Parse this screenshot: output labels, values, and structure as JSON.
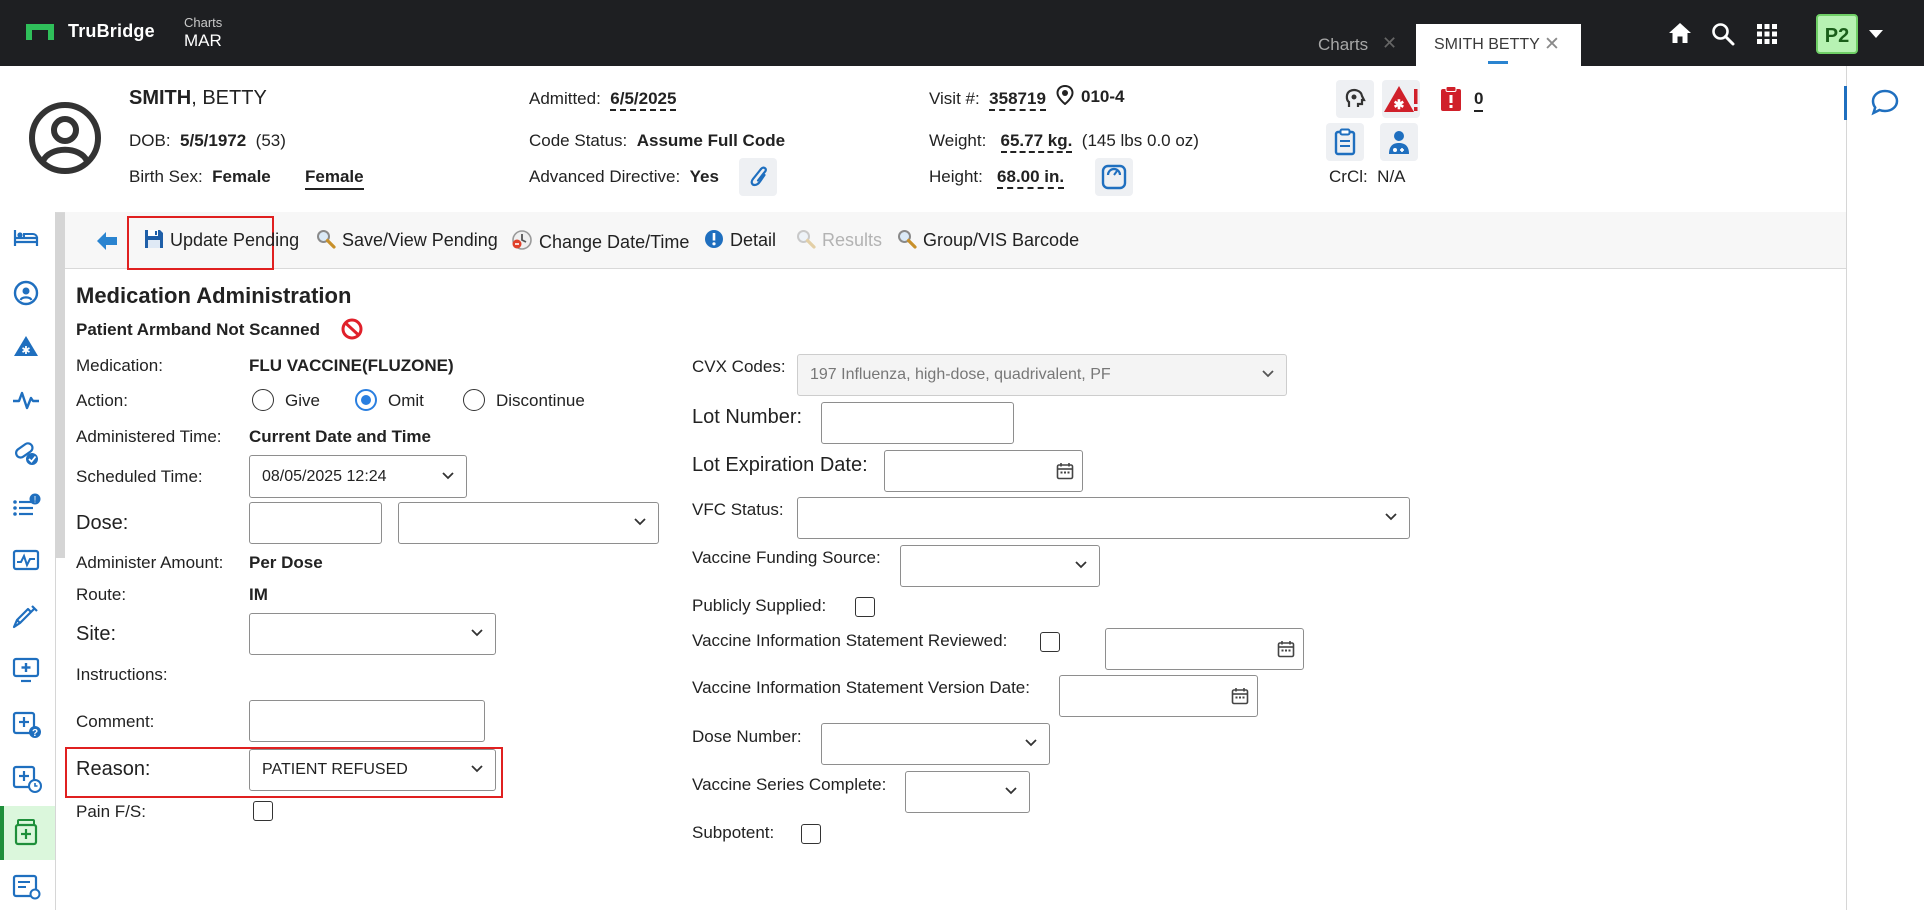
{
  "app": {
    "brand": "TruBridge",
    "section": "Charts",
    "page": "MAR",
    "tabs": [
      {
        "label": "Charts",
        "close": "✕"
      },
      {
        "label": "SMITH BETTY",
        "close": "✕"
      }
    ],
    "user_initials": "P2"
  },
  "patient": {
    "last_name": "SMITH",
    "first_name": ", BETTY",
    "dob_label": "DOB:",
    "dob": "5/5/1972",
    "age": "(53)",
    "birth_sex_label": "Birth Sex:",
    "birth_sex": "Female",
    "gender_link": "Female",
    "admitted_label": "Admitted:",
    "admitted": "6/5/2025",
    "code_status_label": "Code Status:",
    "code_status": "Assume Full Code",
    "adv_directive_label": "Advanced Directive:",
    "adv_directive": "Yes",
    "visit_label": "Visit #:",
    "visit": "358719",
    "room": "010-4",
    "weight_label": "Weight:",
    "weight": "65.77 kg.",
    "weight_lbs": "(145 lbs 0.0 oz)",
    "height_label": "Height:",
    "height": "68.00 in.",
    "alerts_count": "0",
    "crcl_label": "CrCl:",
    "crcl": "N/A"
  },
  "toolbar": {
    "update_pending": "Update Pending",
    "save_view_pending": "Save/View Pending",
    "change_datetime": "Change Date/Time",
    "detail": "Detail",
    "results": "Results",
    "group_vis_barcode": "Group/VIS Barcode"
  },
  "form": {
    "title": "Medication Administration",
    "armband": "Patient Armband Not Scanned",
    "medication_label": "Medication:",
    "medication": "FLU VACCINE(FLUZONE)",
    "action_label": "Action:",
    "action_options": [
      "Give",
      "Omit",
      "Discontinue"
    ],
    "action_selected": "Omit",
    "admin_time_label": "Administered Time:",
    "admin_time": "Current Date and Time",
    "scheduled_time_label": "Scheduled Time:",
    "scheduled_time": "08/05/2025 12:24",
    "dose_label": "Dose:",
    "dose_value": "",
    "dose_unit": "",
    "administer_amount_label": "Administer Amount:",
    "administer_amount": "Per Dose",
    "route_label": "Route:",
    "route": "IM",
    "site_label": "Site:",
    "site": "",
    "instructions_label": "Instructions:",
    "comment_label": "Comment:",
    "comment": "",
    "reason_label": "Reason:",
    "reason": "PATIENT REFUSED",
    "pain_label": "Pain F/S:",
    "pain_checked": false
  },
  "vaccine": {
    "cvx_label": "CVX Codes:",
    "cvx_value": "197 Influenza, high-dose, quadrivalent, PF",
    "lot_number_label": "Lot Number:",
    "lot_number": "",
    "lot_exp_label": "Lot Expiration Date:",
    "lot_exp": "",
    "vfc_label": "VFC Status:",
    "vfc": "",
    "funding_label": "Vaccine Funding Source:",
    "funding": "",
    "publicly_supplied_label": "Publicly Supplied:",
    "vis_reviewed_label": "Vaccine Information Statement Reviewed:",
    "vis_reviewed_date": "",
    "vis_version_label": "Vaccine Information Statement Version Date:",
    "vis_version_date": "",
    "dose_number_label": "Dose Number:",
    "dose_number": "",
    "series_complete_label": "Vaccine Series Complete:",
    "series_complete": "",
    "subpotent_label": "Subpotent:"
  },
  "colors": {
    "topbar": "#1e1f22",
    "accent_blue": "#1f6fbf",
    "alert_red": "#d0202a",
    "highlight_box": "#e02020",
    "nav_selected": "#dbf7dc"
  }
}
